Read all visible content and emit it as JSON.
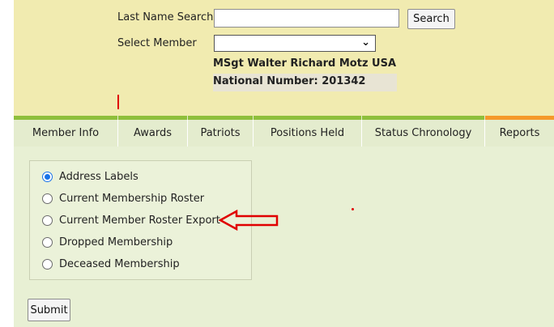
{
  "search": {
    "last_name_label": "Last Name Search",
    "last_name_value": "",
    "search_button": "Search",
    "select_member_label": "Select Member",
    "select_member_value": ""
  },
  "member": {
    "name": "MSgt Walter Richard Motz USA",
    "national_number": "National Number: 201342"
  },
  "tabs": [
    {
      "label": "Member Info"
    },
    {
      "label": "Awards"
    },
    {
      "label": "Patriots"
    },
    {
      "label": "Positions Held"
    },
    {
      "label": "Status Chronology"
    },
    {
      "label": "Reports",
      "active": true
    }
  ],
  "reports": {
    "options": [
      {
        "label": "Address Labels",
        "checked": true
      },
      {
        "label": "Current Membership Roster",
        "checked": false
      },
      {
        "label": "Current Member Roster Export",
        "checked": false
      },
      {
        "label": "Dropped Membership",
        "checked": false
      },
      {
        "label": "Deceased Membership",
        "checked": false
      }
    ],
    "submit_button": "Submit"
  },
  "colors": {
    "header_bg": "#f1ebb0",
    "tab_accent": "#8ebf3b",
    "active_tab_accent": "#f5992a",
    "content_bg": "#e8f0d4",
    "annotation_red": "#e00000"
  }
}
